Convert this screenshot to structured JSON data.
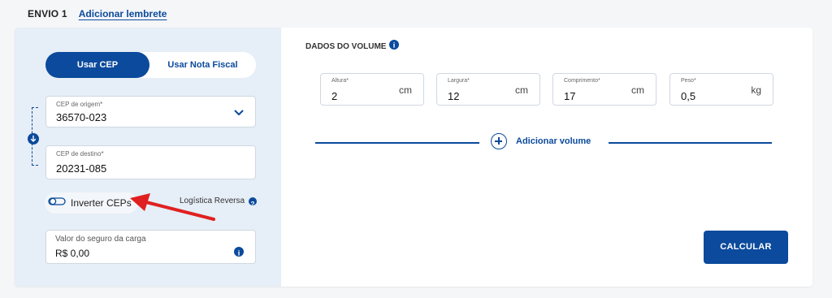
{
  "header": {
    "shipment_label": "ENVIO 1",
    "reminder_link": "Adicionar lembrete"
  },
  "mode_toggle": {
    "active": "Usar CEP",
    "other": "Usar Nota Fiscal"
  },
  "origin": {
    "label": "CEP de origem*",
    "value": "36570-023"
  },
  "destination": {
    "label": "CEP de destino*",
    "value": "20231-085"
  },
  "swap": {
    "label": "Inverter CEPs"
  },
  "reverse_logistics": {
    "label": "Logística Reversa"
  },
  "insurance": {
    "label": "Valor do seguro da carga",
    "value": "R$ 0,00"
  },
  "volume": {
    "title": "DADOS DO VOLUME",
    "fields": [
      {
        "label": "Altura*",
        "value": "2",
        "unit": "cm"
      },
      {
        "label": "Largura*",
        "value": "12",
        "unit": "cm"
      },
      {
        "label": "Comprimento*",
        "value": "17",
        "unit": "cm"
      },
      {
        "label": "Peso*",
        "value": "0,5",
        "unit": "kg"
      }
    ],
    "add_label": "Adicionar volume"
  },
  "calculate_button": "CALCULAR",
  "colors": {
    "primary": "#0b4a9c",
    "left_panel": "#e6eef7",
    "annotation_arrow": "#e02020"
  },
  "icons": [
    "chevron-down-icon",
    "swap-arrow-icon",
    "toggle-icon",
    "help-icon",
    "info-icon",
    "add-circle-icon",
    "annotation-arrow-icon"
  ]
}
